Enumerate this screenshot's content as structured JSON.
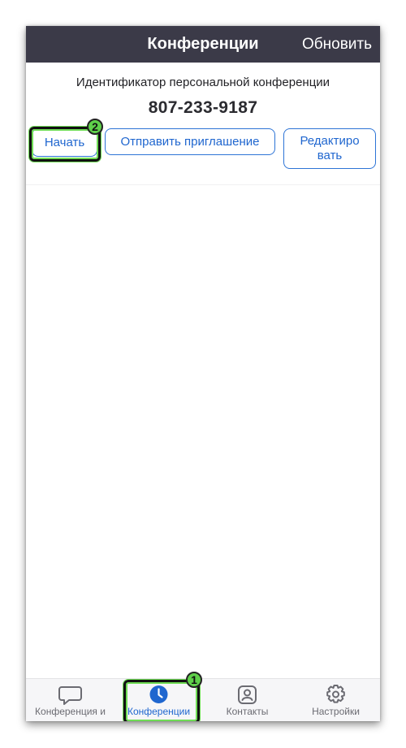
{
  "header": {
    "title": "Конференции",
    "refresh_label": "Обновить"
  },
  "pmi": {
    "label": "Идентификатор персональной конференции",
    "number": "807-233-9187"
  },
  "actions": {
    "start_label": "Начать",
    "invite_label": "Отправить приглашение",
    "edit_label": "Редактиро вать"
  },
  "annotations": {
    "badge_1": "1",
    "badge_2": "2",
    "highlight_color": "#5fd04a"
  },
  "bottom_nav": {
    "items": [
      {
        "label": "Конференция и",
        "icon": "chat-bubble-icon",
        "active": false
      },
      {
        "label": "Конференции",
        "icon": "clock-icon",
        "active": true
      },
      {
        "label": "Контакты",
        "icon": "contact-icon",
        "active": false
      },
      {
        "label": "Настройки",
        "icon": "gear-icon",
        "active": false
      }
    ]
  },
  "colors": {
    "header_bg": "#3b3a48",
    "accent": "#1f66cf"
  }
}
